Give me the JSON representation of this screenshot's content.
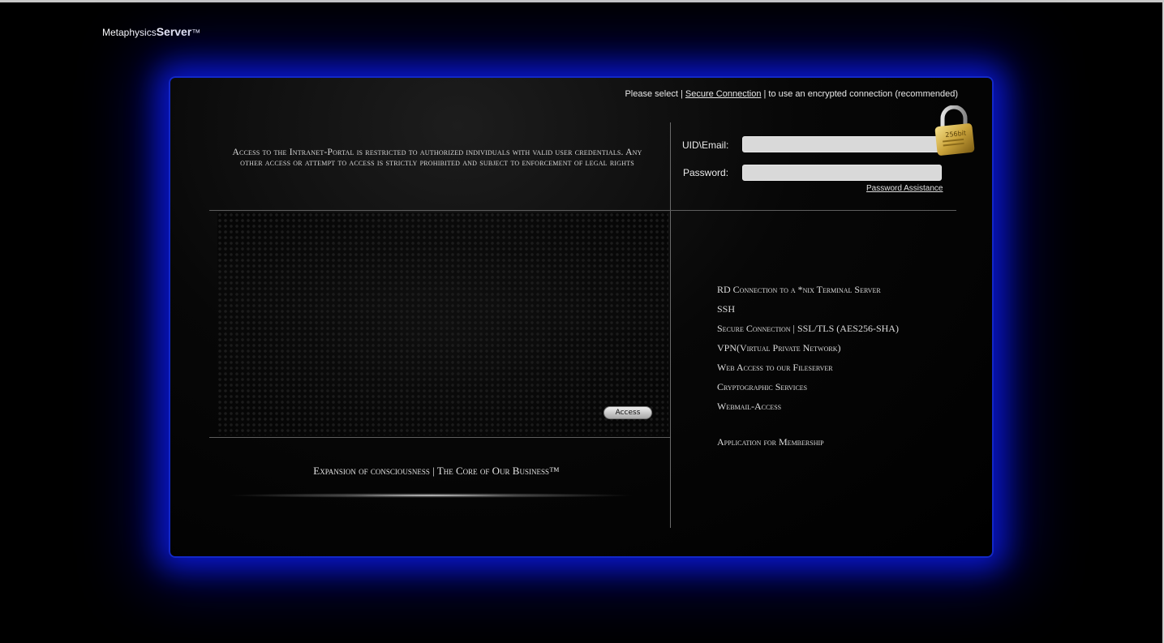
{
  "brand": {
    "prefix": "Metaphysics",
    "strong": "Server",
    "tm": "™"
  },
  "secure_note": {
    "before": "Please select | ",
    "link": "Secure Connection",
    "after": " | to use an encrypted connection (recommended)"
  },
  "notice": "Access to the Intranet-Portal is restricted to authorized individuals with valid user credentials. Any other access or attempt to access is strictly prohibited and subject to enforcement of legal rights",
  "login": {
    "uid_label": "UID\\Email:",
    "uid_value": "",
    "password_label": "Password:",
    "password_value": "",
    "assist": "Password Assistance"
  },
  "lock": {
    "label": "256bit",
    "icon": "padlock-icon",
    "color": "#d4b040"
  },
  "access_button": "Access",
  "slogan": "Expansion of consciousness | The Core of Our Business™",
  "services": [
    "RD Connection to a *nix Terminal Server",
    "SSH",
    "Secure Connection | SSL/TLS (AES256-SHA)",
    "VPN(Virtual Private Network)",
    "Web Access to our Fileserver",
    "Cryptographic Services",
    "Webmail-Access"
  ],
  "membership": "Application for Membership",
  "colors": {
    "glow": "#1228c8",
    "background": "#000000"
  }
}
